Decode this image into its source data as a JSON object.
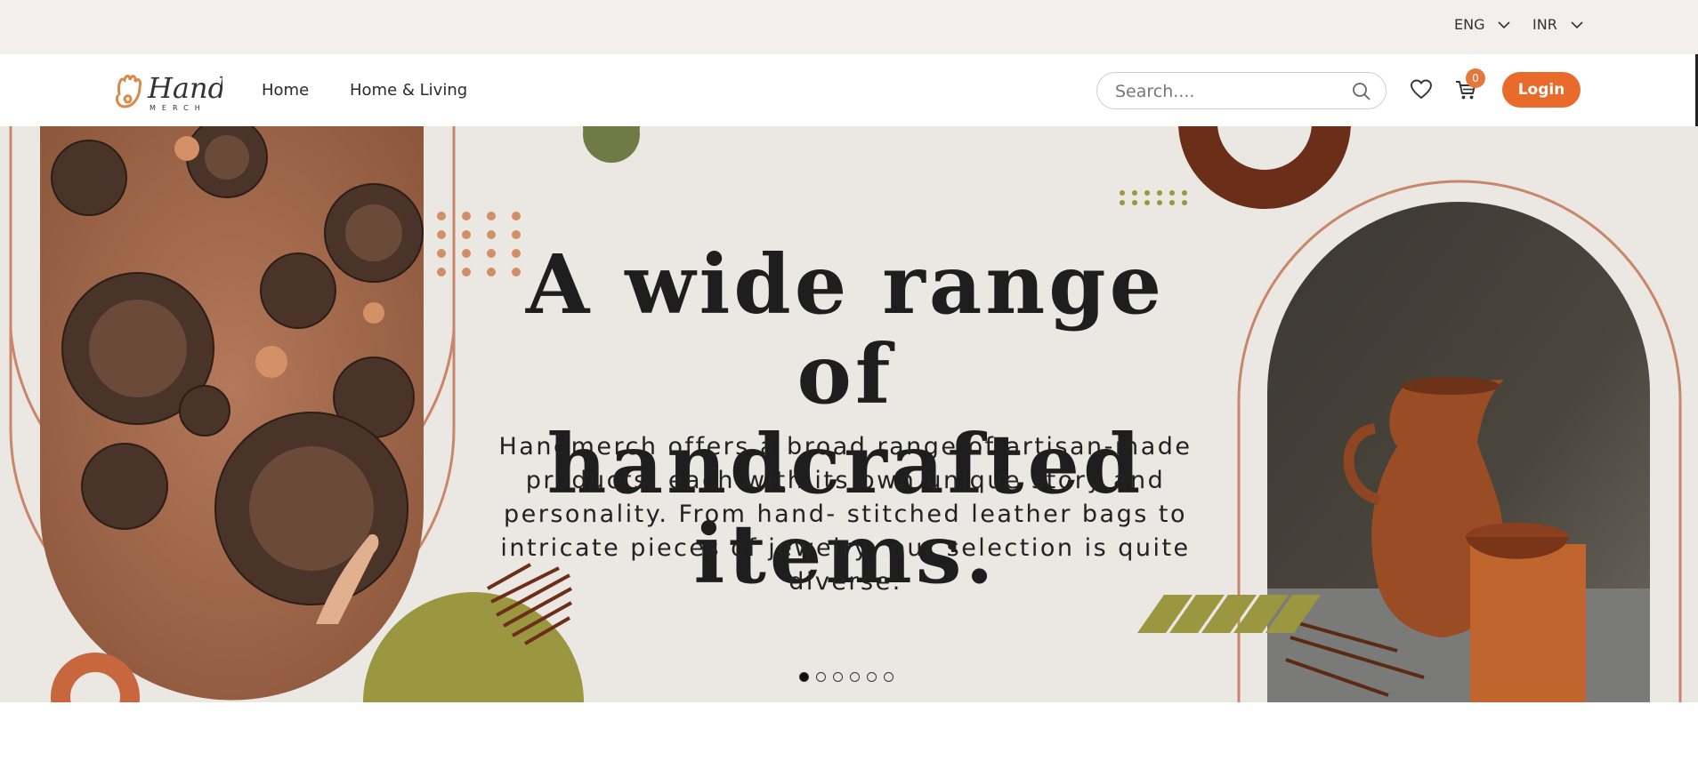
{
  "topbar": {
    "language": "ENG",
    "currency": "INR"
  },
  "nav": {
    "logo_text": "Hand",
    "logo_subtext": "MERCH",
    "links": [
      {
        "label": "Home"
      },
      {
        "label": "Home & Living"
      }
    ],
    "search": {
      "placeholder": "Search...."
    },
    "cart_count": "0",
    "login_label": "Login"
  },
  "hero": {
    "headline_line1": "A wide range of",
    "headline_line2": "handcrafted items.",
    "description": "Handmerch offers a broad range of artisan-made products, each with its own unique story and personality. From hand- stitched leather bags to intricate pieces of jewelry, our selection is quite diverse.",
    "slides": 6,
    "active_slide": 0
  },
  "colors": {
    "accent": "#ea6a2b",
    "brown": "#6b2e19",
    "olive": "#9b9740",
    "green": "#6f7a45",
    "clay": "#c8876a",
    "hero_bg": "#ebe7e3",
    "topbar_bg": "#f2efec"
  },
  "icons": [
    "chevron-down-icon",
    "search-icon",
    "heart-icon",
    "cart-icon"
  ]
}
